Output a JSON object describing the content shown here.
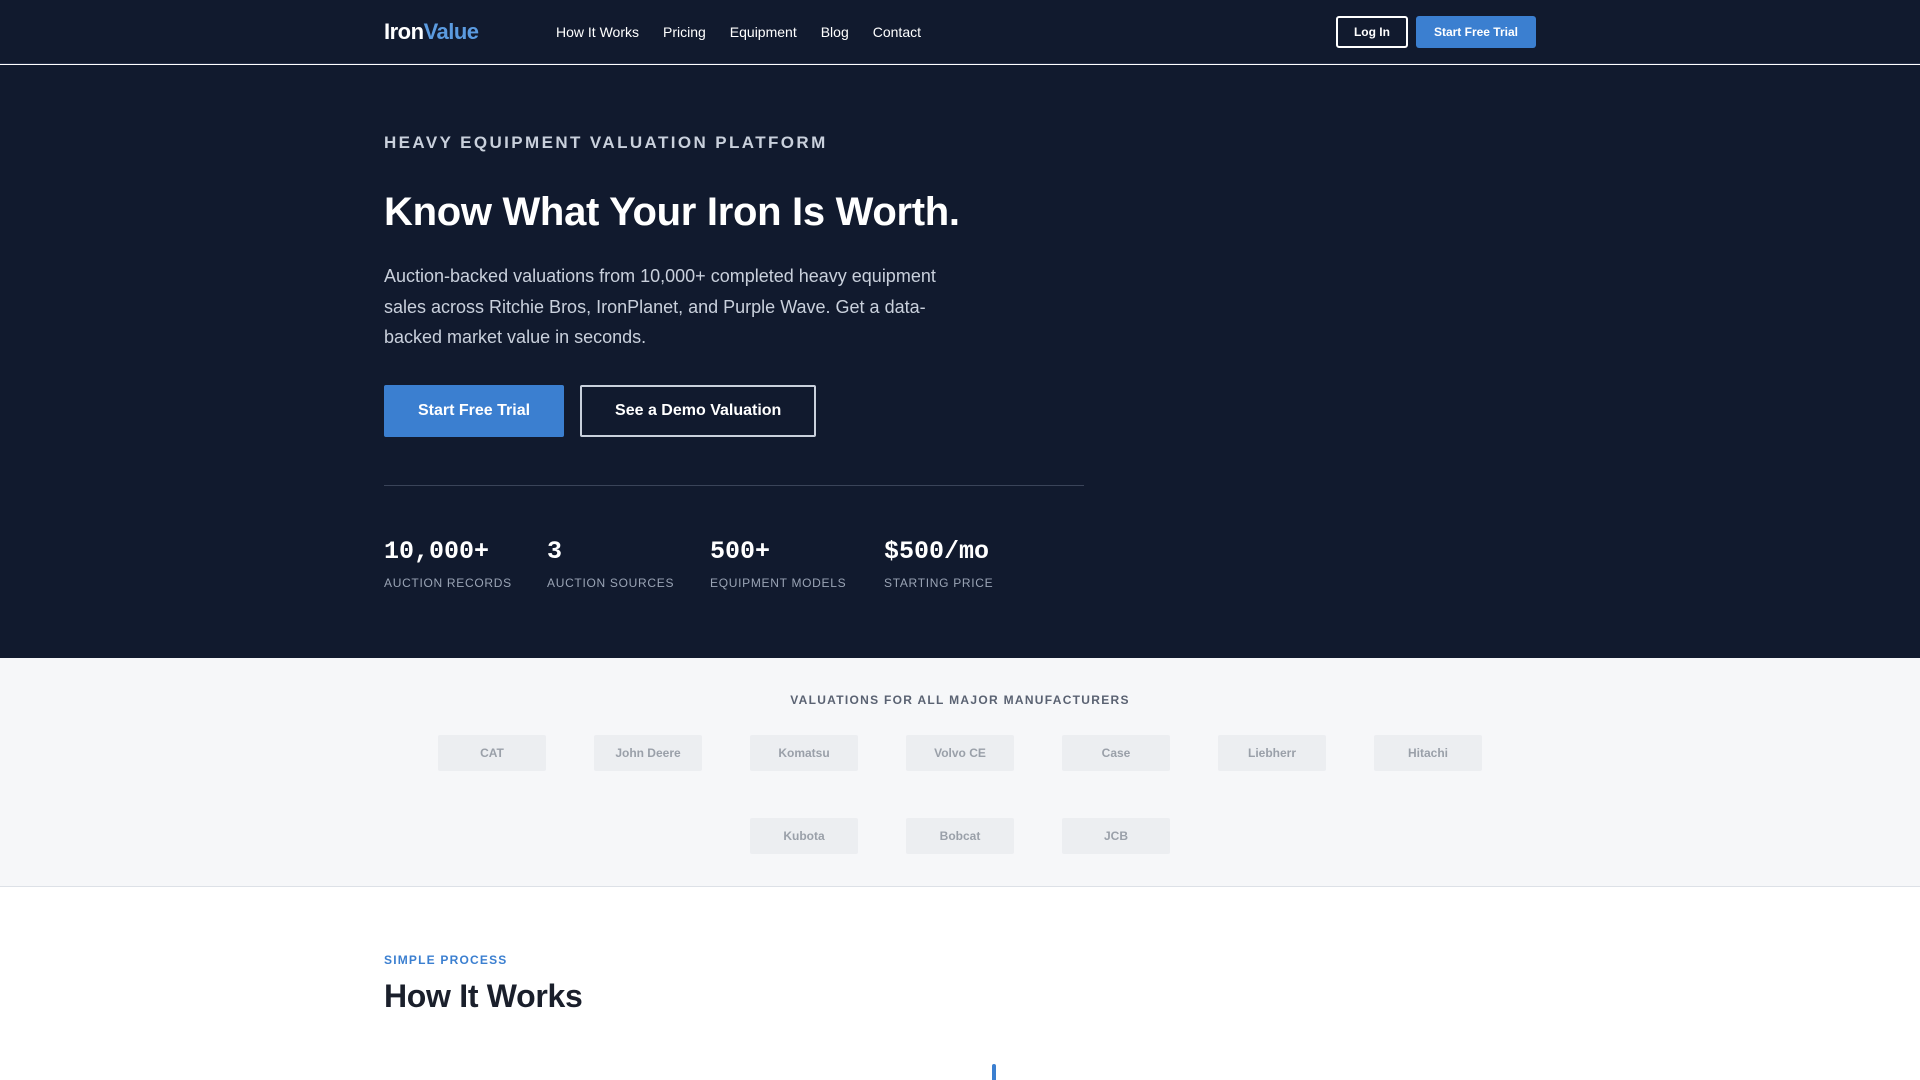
{
  "brand": {
    "logo_primary": "Iron",
    "logo_accent": "Value"
  },
  "nav": {
    "links": [
      "How It Works",
      "Pricing",
      "Equipment",
      "Blog",
      "Contact"
    ],
    "login_label": "Log In",
    "trial_label": "Start Free Trial"
  },
  "hero": {
    "eyebrow": "HEAVY EQUIPMENT VALUATION PLATFORM",
    "headline": "Know What Your Iron Is Worth.",
    "subcopy": "Auction-backed valuations from 10,000+ completed heavy equipment sales across Ritchie Bros, IronPlanet, and Purple Wave. Get a data-backed market value in seconds.",
    "primary_cta": "Start Free Trial",
    "secondary_cta": "See a Demo Valuation",
    "stats": [
      {
        "value": "10,000+",
        "label": "AUCTION RECORDS"
      },
      {
        "value": "3",
        "label": "AUCTION SOURCES"
      },
      {
        "value": "500+",
        "label": "EQUIPMENT MODELS"
      },
      {
        "value": "$500/mo",
        "label": "STARTING PRICE"
      }
    ]
  },
  "manufacturers": {
    "title": "VALUATIONS FOR ALL MAJOR MANUFACTURERS",
    "row1": [
      "CAT",
      "John Deere",
      "Komatsu",
      "Volvo CE",
      "Case",
      "Liebherr",
      "Hitachi"
    ],
    "row2": [
      "Kubota",
      "Bobcat",
      "JCB"
    ]
  },
  "how_it_works": {
    "eyebrow": "SIMPLE PROCESS",
    "title": "How It Works"
  },
  "colors": {
    "navy": "#111a2e",
    "accent_blue": "#3b7fd0",
    "logo_accent": "#5b9be0",
    "light_band": "#f6f7f9"
  }
}
